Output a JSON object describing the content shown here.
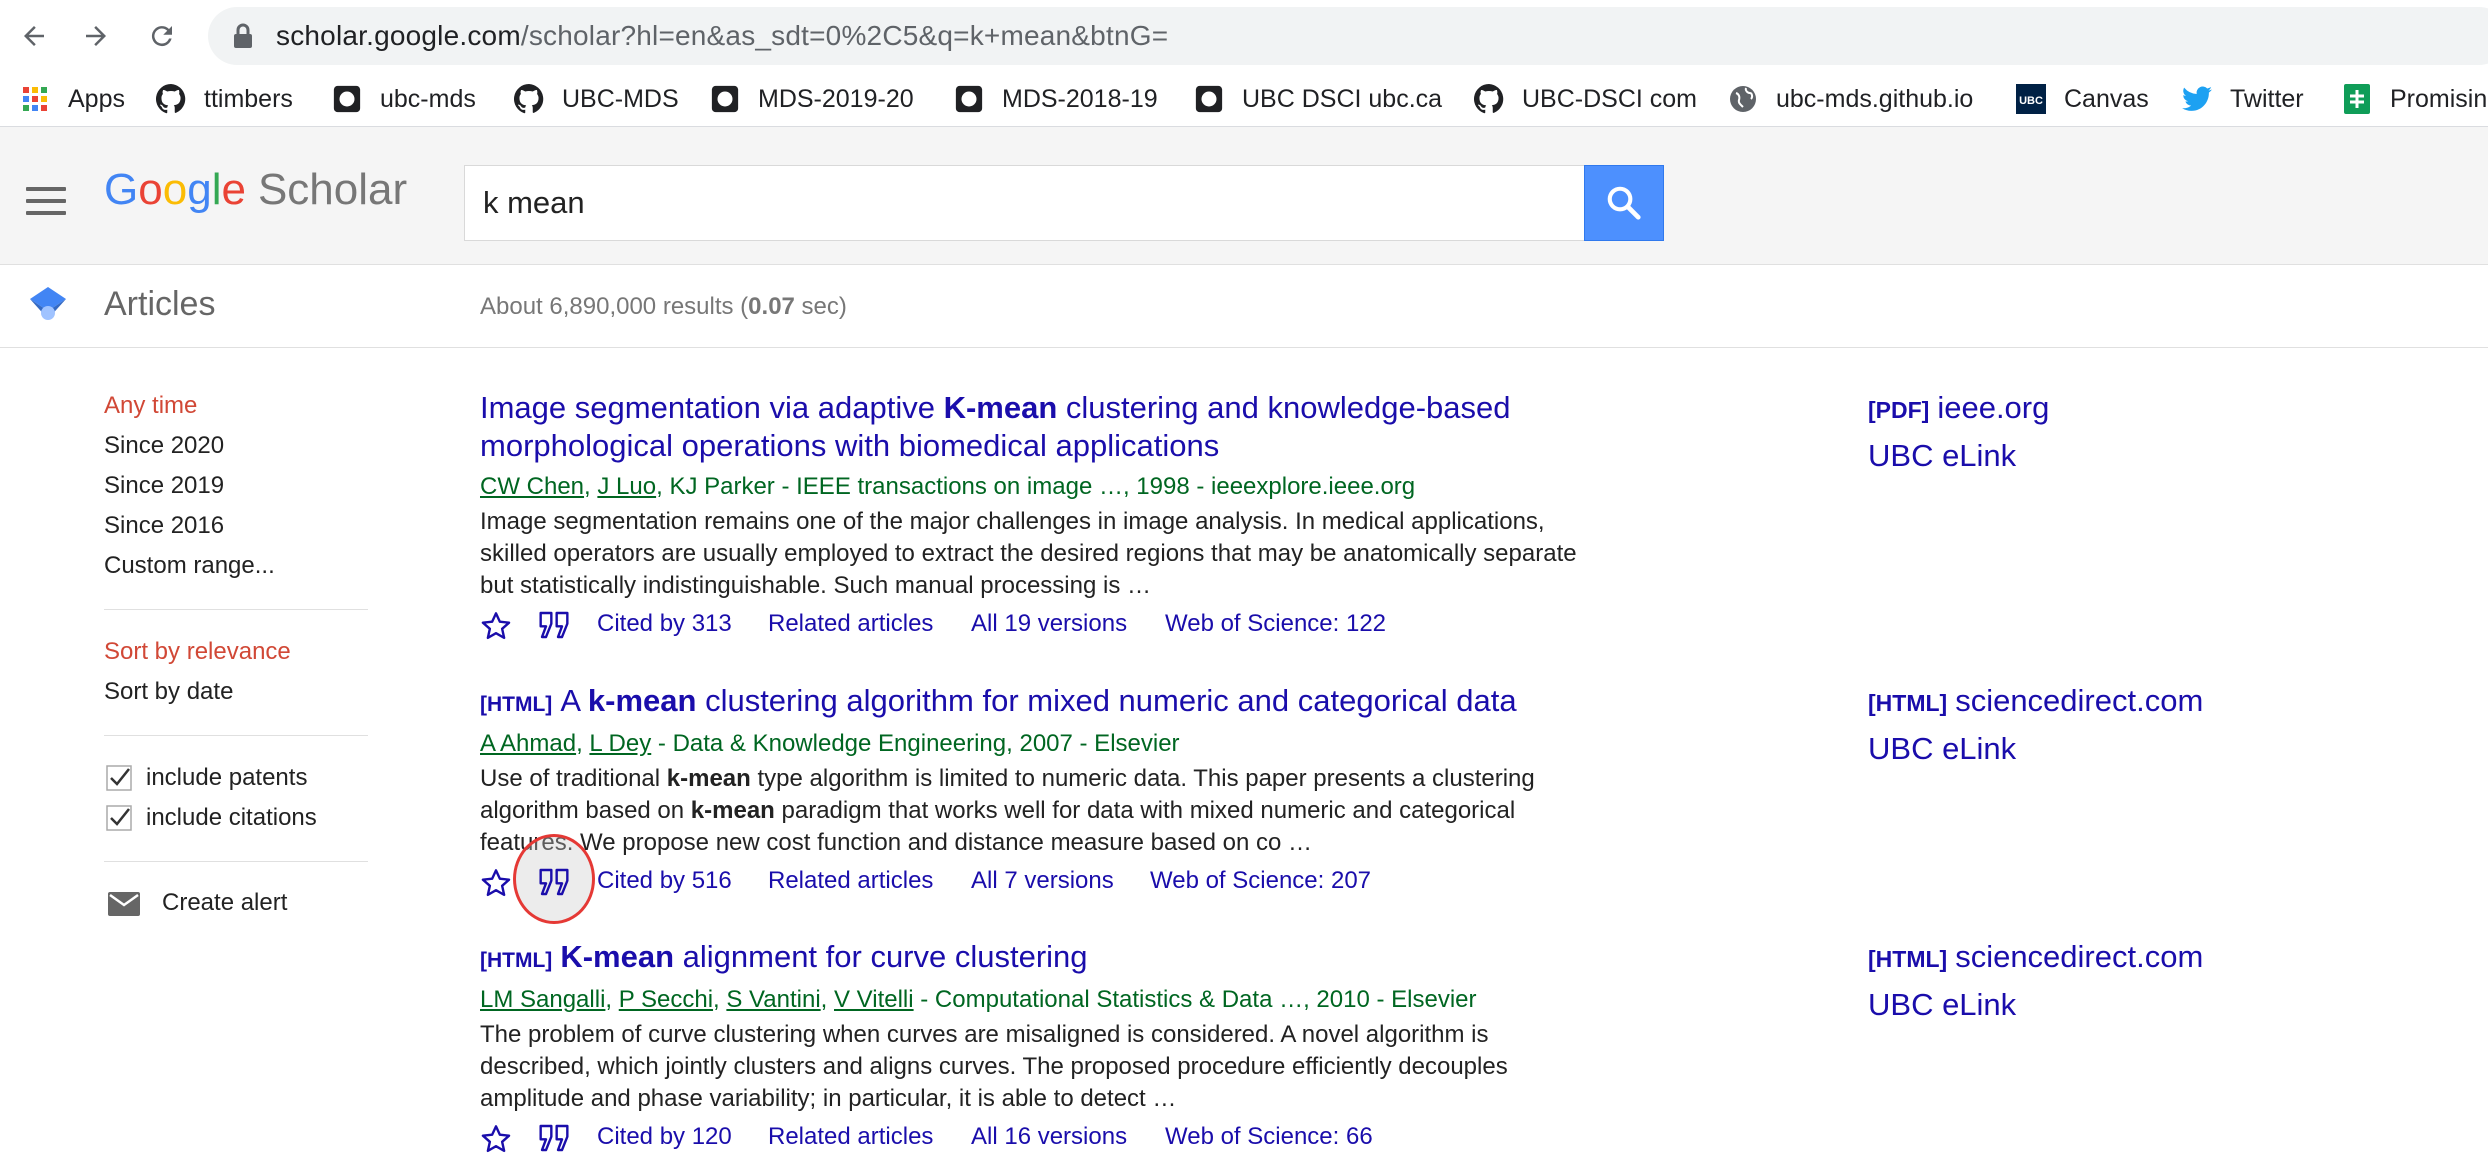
{
  "browser": {
    "url_host": "scholar.google.com",
    "url_rest": "/scholar?hl=en&as_sdt=0%2C5&q=k+mean&btnG=",
    "bookmarks": [
      {
        "label": "Apps",
        "icon": "apps-grid-icon"
      },
      {
        "label": "ttimbers",
        "icon": "github-icon"
      },
      {
        "label": "ubc-mds",
        "icon": "github-icon"
      },
      {
        "label": "UBC-MDS",
        "icon": "github-icon"
      },
      {
        "label": "MDS-2019-20",
        "icon": "github-icon"
      },
      {
        "label": "MDS-2018-19",
        "icon": "github-icon"
      },
      {
        "label": "UBC DSCI ubc.ca",
        "icon": "github-icon"
      },
      {
        "label": "UBC-DSCI com",
        "icon": "github-icon"
      },
      {
        "label": "ubc-mds.github.io",
        "icon": "globe-icon"
      },
      {
        "label": "Canvas",
        "icon": "canvas-icon"
      },
      {
        "label": "Twitter",
        "icon": "twitter-icon"
      },
      {
        "label": "Promisin",
        "icon": "sheets-icon"
      }
    ]
  },
  "header": {
    "logo_google": "Google",
    "logo_scholar": "Scholar",
    "search_query": "k mean"
  },
  "section": {
    "title": "Articles",
    "stats_prefix": "About 6,890,000 results (",
    "stats_time": "0.07",
    "stats_suffix": " sec)"
  },
  "sidebar": {
    "time_filters": [
      "Any time",
      "Since 2020",
      "Since 2019",
      "Since 2016",
      "Custom range..."
    ],
    "sort_options": [
      "Sort by relevance",
      "Sort by date"
    ],
    "include_patents": "include patents",
    "include_citations": "include citations",
    "create_alert": "Create alert"
  },
  "results": [
    {
      "title_pre": "Image segmentation via adaptive ",
      "title_bold": "K-mean",
      "title_post": " clustering and knowledge-based morphological operations with biomedical applications",
      "authors": [
        "CW Chen",
        "J Luo"
      ],
      "meta_rest": "KJ Parker - IEEE transactions on image …, 1998 - ieeexplore.ieee.org",
      "snippet": "Image segmentation remains one of the major challenges in image analysis. In medical applications, skilled operators are usually employed to extract the desired regions that may be anatomically separate but statistically indistinguishable. Such manual processing is …",
      "cited_by": "Cited by 313",
      "related": "Related articles",
      "versions": "All 19 versions",
      "wos": "Web of Science: 122",
      "side_tag": "[PDF]",
      "side_domain": "ieee.org",
      "side_elink": "UBC eLink"
    },
    {
      "title_tag": "[HTML]",
      "title_pre": "A ",
      "title_bold": "k-mean",
      "title_post": " clustering algorithm for mixed numeric and categorical data",
      "authors": [
        "A Ahmad",
        "L Dey"
      ],
      "meta_rest": "- Data & Knowledge Engineering, 2007 - Elsevier",
      "snippet_parts": [
        "Use of traditional ",
        "k-mean",
        " type algorithm is limited to numeric data. This paper presents a clustering algorithm based on ",
        "k-mean",
        " paradigm that works well for data with mixed numeric and categorical features. We propose new cost function and distance measure based on co …"
      ],
      "cited_by": "Cited by 516",
      "related": "Related articles",
      "versions": "All 7 versions",
      "wos": "Web of Science: 207",
      "side_tag": "[HTML]",
      "side_domain": "sciencedirect.com",
      "side_elink": "UBC eLink"
    },
    {
      "title_tag": "[HTML]",
      "title_bold": "K-mean",
      "title_post": " alignment for curve clustering",
      "authors": [
        "LM Sangalli",
        "P Secchi",
        "S Vantini",
        "V Vitelli"
      ],
      "meta_rest": "- Computational Statistics & Data …, 2010 - Elsevier",
      "snippet": "The problem of curve clustering when curves are misaligned is considered. A novel algorithm is described, which jointly clusters and aligns curves. The proposed procedure efficiently decouples amplitude and phase variability; in particular, it is able to detect …",
      "cited_by": "Cited by 120",
      "related": "Related articles",
      "versions": "All 16 versions",
      "wos": "Web of Science: 66",
      "side_tag": "[HTML]",
      "side_domain": "sciencedirect.com",
      "side_elink": "UBC eLink"
    }
  ],
  "colors": {
    "link": "#1a0dab",
    "meta_green": "#006621",
    "active_red": "#d14836",
    "search_blue": "#4d90fe",
    "highlight": "#e53935"
  }
}
